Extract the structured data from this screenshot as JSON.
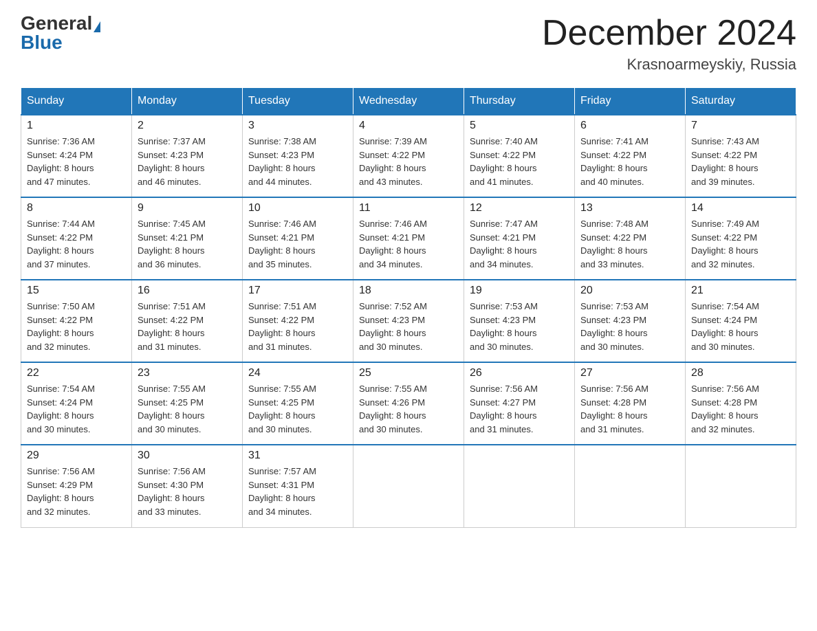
{
  "header": {
    "logo_general": "General",
    "logo_blue": "Blue",
    "month_title": "December 2024",
    "location": "Krasnoarmeyskiy, Russia"
  },
  "days_of_week": [
    "Sunday",
    "Monday",
    "Tuesday",
    "Wednesday",
    "Thursday",
    "Friday",
    "Saturday"
  ],
  "weeks": [
    [
      {
        "num": "1",
        "sunrise": "7:36 AM",
        "sunset": "4:24 PM",
        "daylight": "8 hours and 47 minutes."
      },
      {
        "num": "2",
        "sunrise": "7:37 AM",
        "sunset": "4:23 PM",
        "daylight": "8 hours and 46 minutes."
      },
      {
        "num": "3",
        "sunrise": "7:38 AM",
        "sunset": "4:23 PM",
        "daylight": "8 hours and 44 minutes."
      },
      {
        "num": "4",
        "sunrise": "7:39 AM",
        "sunset": "4:22 PM",
        "daylight": "8 hours and 43 minutes."
      },
      {
        "num": "5",
        "sunrise": "7:40 AM",
        "sunset": "4:22 PM",
        "daylight": "8 hours and 41 minutes."
      },
      {
        "num": "6",
        "sunrise": "7:41 AM",
        "sunset": "4:22 PM",
        "daylight": "8 hours and 40 minutes."
      },
      {
        "num": "7",
        "sunrise": "7:43 AM",
        "sunset": "4:22 PM",
        "daylight": "8 hours and 39 minutes."
      }
    ],
    [
      {
        "num": "8",
        "sunrise": "7:44 AM",
        "sunset": "4:22 PM",
        "daylight": "8 hours and 37 minutes."
      },
      {
        "num": "9",
        "sunrise": "7:45 AM",
        "sunset": "4:21 PM",
        "daylight": "8 hours and 36 minutes."
      },
      {
        "num": "10",
        "sunrise": "7:46 AM",
        "sunset": "4:21 PM",
        "daylight": "8 hours and 35 minutes."
      },
      {
        "num": "11",
        "sunrise": "7:46 AM",
        "sunset": "4:21 PM",
        "daylight": "8 hours and 34 minutes."
      },
      {
        "num": "12",
        "sunrise": "7:47 AM",
        "sunset": "4:21 PM",
        "daylight": "8 hours and 34 minutes."
      },
      {
        "num": "13",
        "sunrise": "7:48 AM",
        "sunset": "4:22 PM",
        "daylight": "8 hours and 33 minutes."
      },
      {
        "num": "14",
        "sunrise": "7:49 AM",
        "sunset": "4:22 PM",
        "daylight": "8 hours and 32 minutes."
      }
    ],
    [
      {
        "num": "15",
        "sunrise": "7:50 AM",
        "sunset": "4:22 PM",
        "daylight": "8 hours and 32 minutes."
      },
      {
        "num": "16",
        "sunrise": "7:51 AM",
        "sunset": "4:22 PM",
        "daylight": "8 hours and 31 minutes."
      },
      {
        "num": "17",
        "sunrise": "7:51 AM",
        "sunset": "4:22 PM",
        "daylight": "8 hours and 31 minutes."
      },
      {
        "num": "18",
        "sunrise": "7:52 AM",
        "sunset": "4:23 PM",
        "daylight": "8 hours and 30 minutes."
      },
      {
        "num": "19",
        "sunrise": "7:53 AM",
        "sunset": "4:23 PM",
        "daylight": "8 hours and 30 minutes."
      },
      {
        "num": "20",
        "sunrise": "7:53 AM",
        "sunset": "4:23 PM",
        "daylight": "8 hours and 30 minutes."
      },
      {
        "num": "21",
        "sunrise": "7:54 AM",
        "sunset": "4:24 PM",
        "daylight": "8 hours and 30 minutes."
      }
    ],
    [
      {
        "num": "22",
        "sunrise": "7:54 AM",
        "sunset": "4:24 PM",
        "daylight": "8 hours and 30 minutes."
      },
      {
        "num": "23",
        "sunrise": "7:55 AM",
        "sunset": "4:25 PM",
        "daylight": "8 hours and 30 minutes."
      },
      {
        "num": "24",
        "sunrise": "7:55 AM",
        "sunset": "4:25 PM",
        "daylight": "8 hours and 30 minutes."
      },
      {
        "num": "25",
        "sunrise": "7:55 AM",
        "sunset": "4:26 PM",
        "daylight": "8 hours and 30 minutes."
      },
      {
        "num": "26",
        "sunrise": "7:56 AM",
        "sunset": "4:27 PM",
        "daylight": "8 hours and 31 minutes."
      },
      {
        "num": "27",
        "sunrise": "7:56 AM",
        "sunset": "4:28 PM",
        "daylight": "8 hours and 31 minutes."
      },
      {
        "num": "28",
        "sunrise": "7:56 AM",
        "sunset": "4:28 PM",
        "daylight": "8 hours and 32 minutes."
      }
    ],
    [
      {
        "num": "29",
        "sunrise": "7:56 AM",
        "sunset": "4:29 PM",
        "daylight": "8 hours and 32 minutes."
      },
      {
        "num": "30",
        "sunrise": "7:56 AM",
        "sunset": "4:30 PM",
        "daylight": "8 hours and 33 minutes."
      },
      {
        "num": "31",
        "sunrise": "7:57 AM",
        "sunset": "4:31 PM",
        "daylight": "8 hours and 34 minutes."
      },
      null,
      null,
      null,
      null
    ]
  ],
  "labels": {
    "sunrise": "Sunrise:",
    "sunset": "Sunset:",
    "daylight": "Daylight:"
  }
}
